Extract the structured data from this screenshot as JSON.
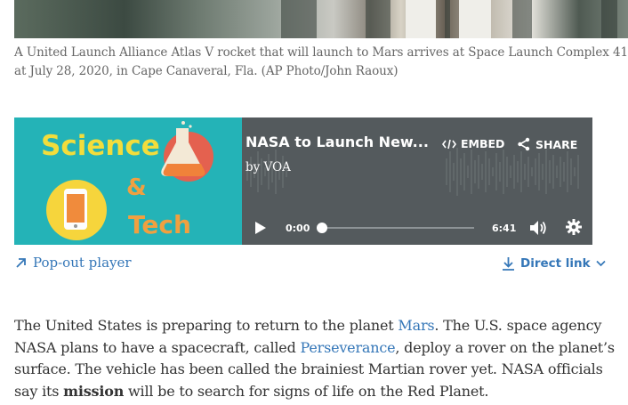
{
  "caption": {
    "text": "A United Launch Alliance Atlas V rocket that will launch to Mars arrives at Space Launch Complex 41 at July 28, 2020, in Cape Canaveral, Fla. (AP Photo/John Raoux)"
  },
  "player": {
    "thumb_words": [
      "Science",
      "&",
      "Tech"
    ],
    "title": "NASA to Launch New...",
    "byline": "by VOA",
    "embed_label": "EMBED",
    "share_label": "SHARE",
    "current_time": "0:00",
    "duration": "6:41",
    "progress": 0
  },
  "links": {
    "popout_label": "Pop-out player",
    "direct_label": "Direct link"
  },
  "article": {
    "s1": "The United States is preparing to return to the planet ",
    "link_mars": "Mars",
    "s2": ". The U.S. space agency NASA plans to have a spacecraft, called ",
    "link_perseverance": "Perseverance",
    "s3": ", deploy a rover on the planet’s surface. The vehicle has been called the brainiest Martian rover yet. NASA officials say its ",
    "bold_mission": "mission",
    "s4": " will be to search for signs of life on the Red Planet."
  },
  "colors": {
    "player_bg": "#545a5d",
    "thumb_bg": "#24b3b7",
    "link": "#3577b8",
    "thumb_text": "#f2dd3c"
  }
}
